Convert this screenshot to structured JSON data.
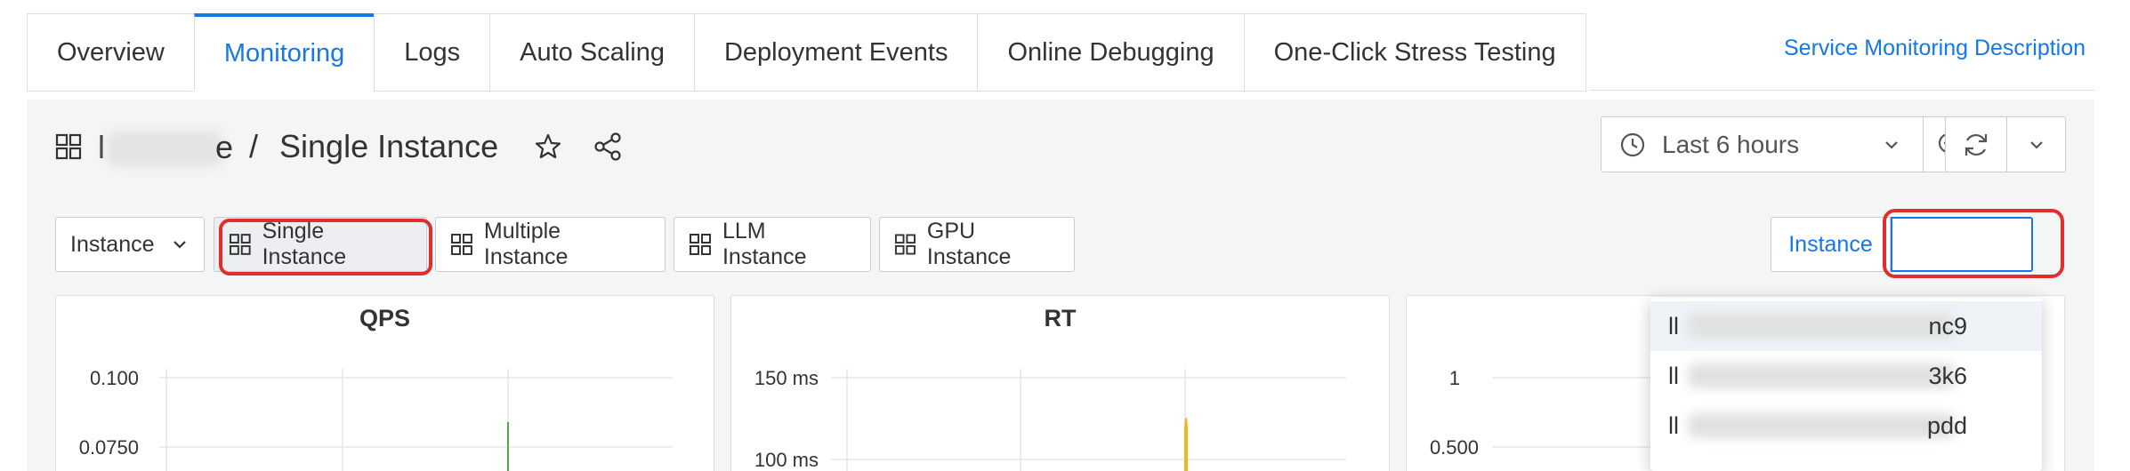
{
  "tabs": [
    {
      "label": "Overview",
      "active": false
    },
    {
      "label": "Monitoring",
      "active": true
    },
    {
      "label": "Logs",
      "active": false
    },
    {
      "label": "Auto Scaling",
      "active": false
    },
    {
      "label": "Deployment Events",
      "active": false
    },
    {
      "label": "Online Debugging",
      "active": false
    },
    {
      "label": "One-Click Stress Testing",
      "active": false
    }
  ],
  "top_link": "Service Monitoring Description",
  "breadcrumb": {
    "prefix_char": "l",
    "suffix_char": "e",
    "separator": "/",
    "title": "Single Instance"
  },
  "time_picker": {
    "label": "Last 6 hours"
  },
  "variables": {
    "instance_dropdown": "Instance",
    "links": [
      "Single Instance",
      "Multiple Instance",
      "LLM Instance",
      "GPU Instance"
    ],
    "instance_label": "Instance",
    "instance_value": ""
  },
  "panels": [
    {
      "title": "QPS",
      "y_ticks": [
        "0.100",
        "0.0750"
      ]
    },
    {
      "title": "RT",
      "y_ticks": [
        "150 ms",
        "100 ms"
      ]
    },
    {
      "title": "",
      "y_ticks": [
        "1",
        "0.500"
      ]
    }
  ],
  "dropdown_options": [
    {
      "prefix": "ll",
      "suffix": "nc9"
    },
    {
      "prefix": "ll",
      "suffix": "3k6"
    },
    {
      "prefix": "ll",
      "suffix": "pdd"
    }
  ],
  "colors": {
    "accent": "#1677e6",
    "highlight": "#e02d2d",
    "qps_line": "#56a64b",
    "rt_line": "#f2b51f"
  }
}
